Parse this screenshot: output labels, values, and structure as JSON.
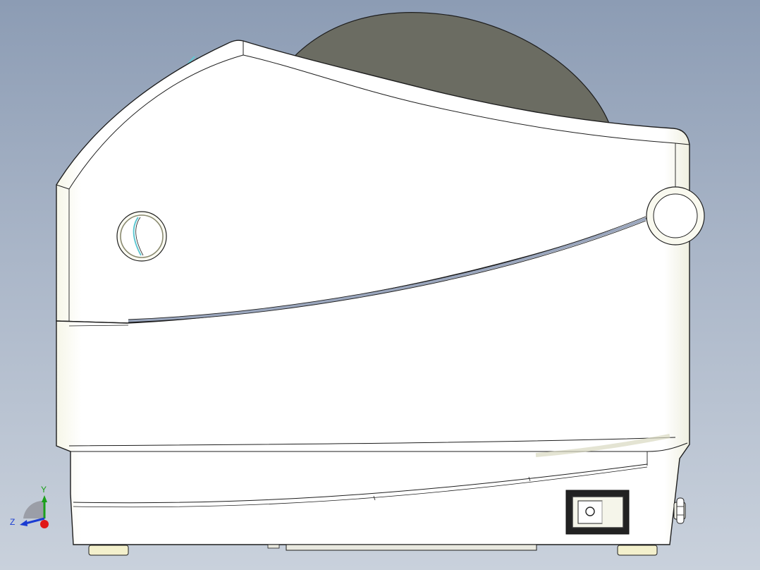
{
  "viewport": {
    "background_top": "#8c9cb4",
    "background_bottom": "#c9d1dc"
  },
  "model": {
    "body_color": "#fefef8",
    "edge_color": "#1e1e1e",
    "spool_color": "#6b6c62",
    "foot_color": "#f3f0cc",
    "accent_line_color": "#5fc8d2"
  },
  "triad": {
    "y_label": "Y",
    "z_label": "Z",
    "y_axis_color": "#1aa01a",
    "z_axis_color": "#1a3cd2",
    "x_origin_color": "#e01818"
  }
}
